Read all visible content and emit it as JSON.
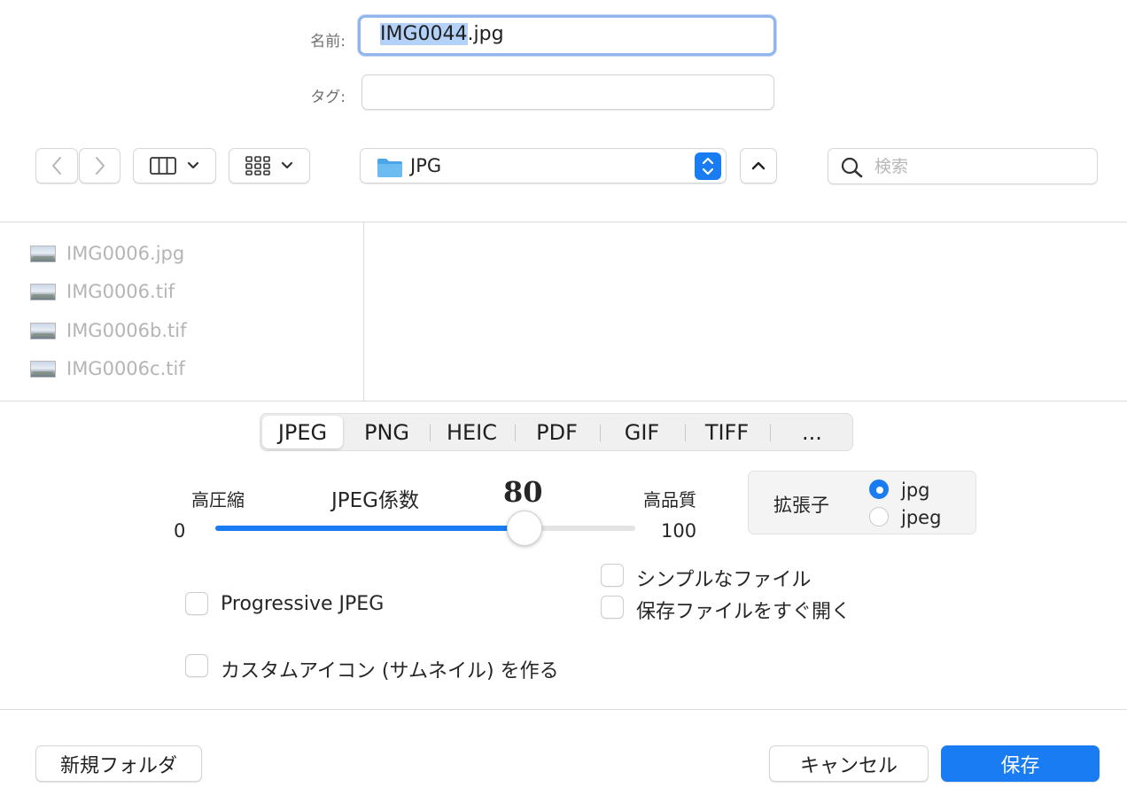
{
  "fields": {
    "name_label": "名前:",
    "name_selected": "IMG0044",
    "name_extension": ".jpg",
    "tag_label": "タグ:",
    "tag_value": ""
  },
  "toolbar": {
    "back_icon": "chevron-left-icon",
    "forward_icon": "chevron-right-icon",
    "view_columns_icon": "columns-view-icon",
    "view_grid_icon": "icon-grid-view-icon",
    "location": "JPG",
    "search_placeholder": "検索"
  },
  "files": [
    {
      "name": "IMG0006.jpg"
    },
    {
      "name": "IMG0006.tif"
    },
    {
      "name": "IMG0006b.tif"
    },
    {
      "name": "IMG0006c.tif"
    }
  ],
  "formats": [
    "JPEG",
    "PNG",
    "HEIC",
    "PDF",
    "GIF",
    "TIFF",
    "..."
  ],
  "selected_format": "JPEG",
  "jpeg": {
    "low_label": "高圧縮",
    "title": "JPEG係数",
    "value": "80",
    "high_label": "高品質",
    "min": "0",
    "max": "100",
    "fraction": 0.8
  },
  "extension": {
    "label": "拡張子",
    "options": [
      {
        "label": "jpg",
        "selected": true
      },
      {
        "label": "jpeg",
        "selected": false
      }
    ]
  },
  "checkboxes": {
    "progressive": "Progressive JPEG",
    "simple_file": "シンプルなファイル",
    "open_after_save": "保存ファイルをすぐ開く",
    "custom_icon": "カスタムアイコン (サムネイル) を作る"
  },
  "buttons": {
    "new_folder": "新規フォルダ",
    "cancel": "キャンセル",
    "save": "保存"
  },
  "colors": {
    "accent": "#1a7cf2",
    "selection": "#b4d1f8"
  }
}
